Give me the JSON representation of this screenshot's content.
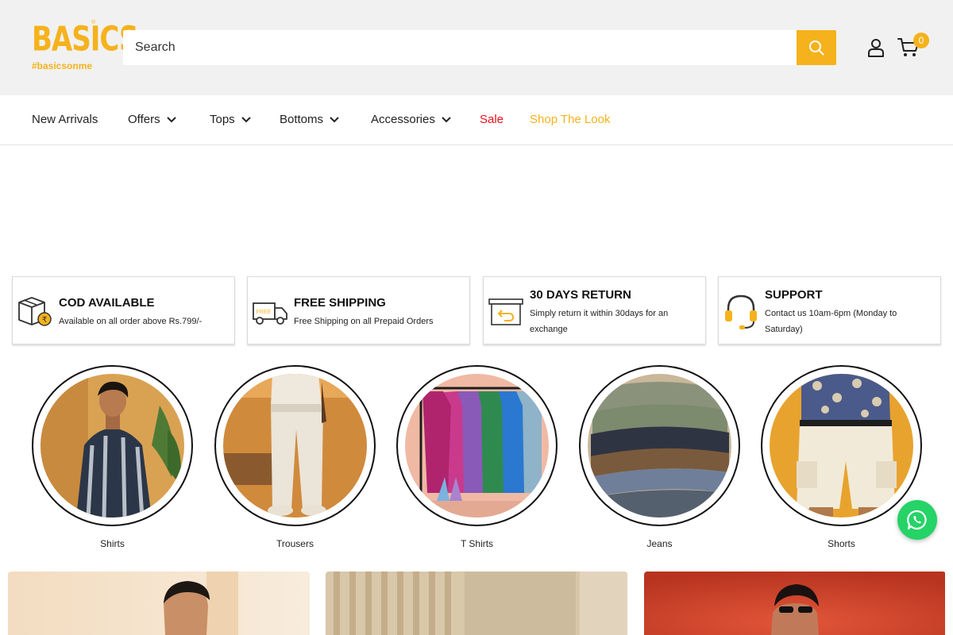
{
  "brand": {
    "logo_text": "BASICS",
    "reg": "®",
    "tagline": "#basicsonme",
    "accent": "#f5b21c"
  },
  "search": {
    "placeholder": "Search",
    "value": ""
  },
  "header": {
    "cart_count": "0"
  },
  "nav": {
    "items": [
      {
        "label": "New Arrivals"
      },
      {
        "label": "Offers"
      },
      {
        "label": "Tops"
      },
      {
        "label": "Bottoms"
      },
      {
        "label": "Accessories"
      },
      {
        "label": "Sale"
      },
      {
        "label": "Shop The Look"
      }
    ]
  },
  "features": [
    {
      "title": "COD AVAILABLE",
      "text": "Available on all order above Rs.799/-",
      "icon": "cod-box-icon"
    },
    {
      "title": "FREE SHIPPING",
      "text": "Free Shipping on all Prepaid Orders",
      "icon": "truck-icon",
      "icon_text": "FREE"
    },
    {
      "title": "30 DAYS RETURN",
      "text": "Simply return it within 30days for an exchange",
      "icon": "return-box-icon"
    },
    {
      "title": "SUPPORT",
      "text": "Contact us 10am-6pm (Monday to Saturday)",
      "icon": "headset-icon"
    }
  ],
  "categories": [
    {
      "label": "Shirts"
    },
    {
      "label": "Trousers"
    },
    {
      "label": "T Shirts"
    },
    {
      "label": "Jeans"
    },
    {
      "label": "Shorts"
    }
  ]
}
